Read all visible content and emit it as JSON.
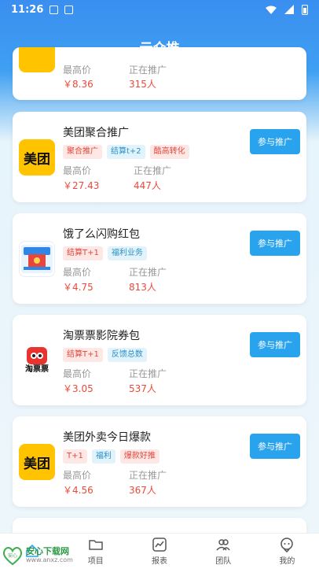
{
  "status_bar": {
    "time": "11:26"
  },
  "nav": {
    "title": "云众推"
  },
  "cards": [
    {
      "title": "",
      "logo": "meituan",
      "logo_text": "",
      "tags": [],
      "max_price_label": "最高价",
      "max_price": "￥8.36",
      "promoting_label": "正在推广",
      "promoting": "315人",
      "button": ""
    },
    {
      "title": "美团聚合推广",
      "logo": "meituan",
      "logo_text": "美团",
      "tags": [
        {
          "text": "聚合推广",
          "color": "red"
        },
        {
          "text": "结算t+2",
          "color": "blue"
        },
        {
          "text": "酷高转化",
          "color": "red"
        }
      ],
      "max_price_label": "最高价",
      "max_price": "￥27.43",
      "promoting_label": "正在推广",
      "promoting": "447人",
      "button": "参与推广"
    },
    {
      "title": "饿了么闪购红包",
      "logo": "eleme",
      "logo_text": "",
      "tags": [
        {
          "text": "结算T+1",
          "color": "red"
        },
        {
          "text": "福利业务",
          "color": "blue"
        }
      ],
      "max_price_label": "最高价",
      "max_price": "￥4.75",
      "promoting_label": "正在推广",
      "promoting": "813人",
      "button": "参与推广"
    },
    {
      "title": "淘票票影院券包",
      "logo": "taopiao",
      "logo_text": "淘票票",
      "tags": [
        {
          "text": "结算T+1",
          "color": "red"
        },
        {
          "text": "反馈总数",
          "color": "blue"
        }
      ],
      "max_price_label": "最高价",
      "max_price": "￥3.05",
      "promoting_label": "正在推广",
      "promoting": "537人",
      "button": "参与推广"
    },
    {
      "title": "美团外卖今日爆款",
      "logo": "meituan",
      "logo_text": "美团",
      "tags": [
        {
          "text": "T+1",
          "color": "red"
        },
        {
          "text": "福利",
          "color": "blue"
        },
        {
          "text": "爆款好推",
          "color": "red"
        }
      ],
      "max_price_label": "最高价",
      "max_price": "￥4.56",
      "promoting_label": "正在推广",
      "promoting": "367人",
      "button": "参与推广"
    }
  ],
  "tabbar": {
    "items": [
      {
        "label": "",
        "icon": "home-icon"
      },
      {
        "label": "项目",
        "icon": "folder-icon"
      },
      {
        "label": "报表",
        "icon": "chart-icon"
      },
      {
        "label": "团队",
        "icon": "team-icon"
      },
      {
        "label": "我的",
        "icon": "user-icon"
      }
    ]
  },
  "watermark": {
    "name": "安心下载网",
    "url": "www.anxz.com",
    "badge": "安心"
  },
  "colors": {
    "accent": "#2aa3ef",
    "price": "#ea4a3a",
    "meituan": "#ffc300"
  }
}
